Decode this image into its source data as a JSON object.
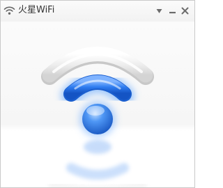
{
  "window": {
    "title": "火星WiFi",
    "app_icon": "wifi-icon"
  },
  "controls": {
    "menu_icon": "chevron-down-icon",
    "minimize_icon": "minimize-icon",
    "close_icon": "close-icon"
  },
  "hero": {
    "icon": "wifi-signal-icon",
    "colors": {
      "accent_blue": "#2c7bf2",
      "outer_arc": "#e6e6e6"
    }
  }
}
